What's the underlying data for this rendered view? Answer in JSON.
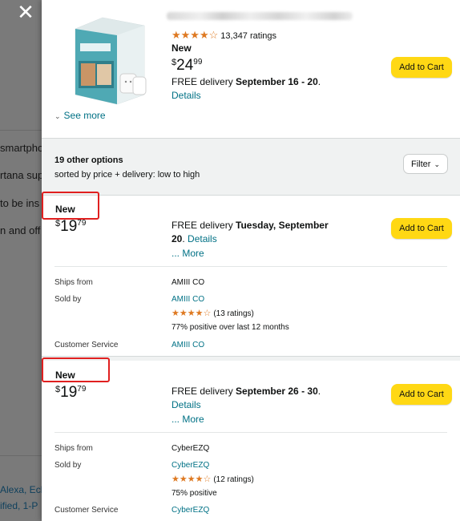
{
  "background": {
    "text_lines": [
      "smartpho",
      "rtana supp",
      "to be ins",
      "n and off v"
    ],
    "link_lines": [
      "Alexa, Ech",
      "ified, 1-P"
    ]
  },
  "top_offer": {
    "rating_stars": "★★★★☆",
    "ratings_count": "13,347 ratings",
    "condition": "New",
    "price_currency": "$",
    "price_whole": "24",
    "price_fraction": "99",
    "delivery_prefix": "FREE delivery ",
    "delivery_dates": "September 16 - 20",
    "delivery_suffix": ".",
    "details_label": "Details",
    "add_to_cart": "Add to Cart",
    "see_more": "See more"
  },
  "options_header": {
    "count_label": "19 other options",
    "sort_label": "sorted by price + delivery: low to high",
    "filter_label": "Filter"
  },
  "offers": [
    {
      "condition": "New",
      "price_currency": "$",
      "price_whole": "19",
      "price_fraction": "79",
      "delivery_prefix": "FREE delivery ",
      "delivery_dates_line1": "Tuesday, September",
      "delivery_dates_line2": "20",
      "delivery_suffix": ". ",
      "details_label": "Details",
      "more_label": "... More",
      "add_to_cart": "Add to Cart",
      "ships_from_label": "Ships from",
      "ships_from": "AMIII CO",
      "sold_by_label": "Sold by",
      "sold_by": "AMIII CO",
      "seller_stars": "★★★★☆",
      "seller_ratings": "(13 ratings)",
      "seller_positive": "77% positive over last 12 months",
      "customer_service_label": "Customer Service",
      "customer_service": "AMIII CO"
    },
    {
      "condition": "New",
      "price_currency": "$",
      "price_whole": "19",
      "price_fraction": "79",
      "delivery_prefix": "FREE delivery ",
      "delivery_dates": "September 26 - 30",
      "delivery_suffix": ".",
      "details_label": "Details",
      "more_label": "... More",
      "add_to_cart": "Add to Cart",
      "ships_from_label": "Ships from",
      "ships_from": "CyberEZQ",
      "sold_by_label": "Sold by",
      "sold_by": "CyberEZQ",
      "seller_stars": "★★★★☆",
      "seller_ratings": "(12 ratings)",
      "seller_positive": "75% positive",
      "customer_service_label": "Customer Service",
      "customer_service": "CyberEZQ"
    }
  ],
  "icons": {
    "close": "close-icon",
    "chevron": "chevron-down-icon"
  },
  "colors": {
    "add_to_cart": "#ffd814",
    "link": "#007185",
    "stars": "#de7921",
    "highlight_box": "#e02020"
  }
}
